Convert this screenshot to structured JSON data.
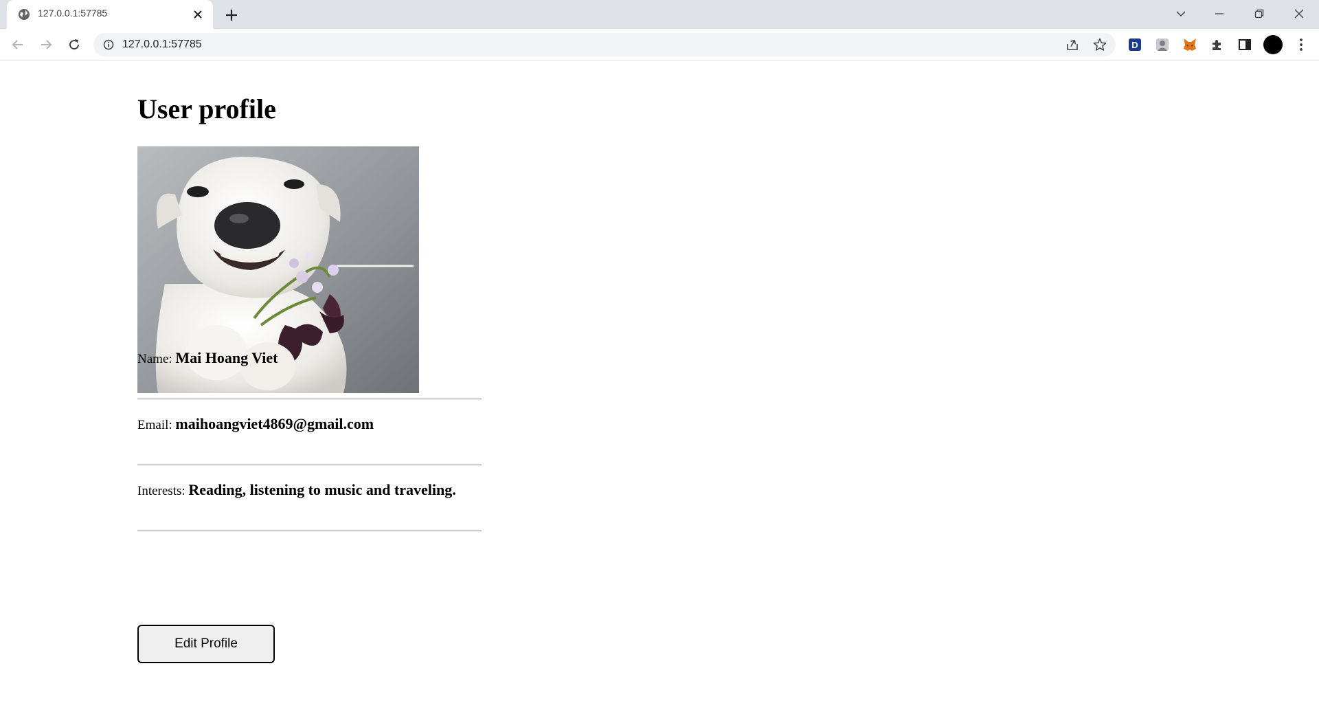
{
  "browser": {
    "tab_title": "127.0.0.1:57785",
    "url": "127.0.0.1:57785"
  },
  "page": {
    "title": "User profile",
    "fields": [
      {
        "label": "Name:",
        "value": "Mai Hoang Viet"
      },
      {
        "label": "Email:",
        "value": "maihoangviet4869@gmail.com"
      },
      {
        "label": "Interests:",
        "value": "Reading, listening to music and traveling."
      }
    ],
    "edit_button": "Edit Profile"
  },
  "icons": {
    "tab_favicon": "globe-icon",
    "tab_close": "close-icon",
    "new_tab": "plus-icon",
    "back": "back-arrow-icon",
    "forward": "forward-arrow-icon",
    "reload": "reload-icon",
    "site_info": "info-icon",
    "share": "share-icon",
    "bookmark": "star-icon",
    "extensions": [
      "dashlane-extension-icon",
      "profile-extension-icon",
      "metamask-fox-icon",
      "puzzle-extensions-icon",
      "side-panel-icon",
      "profile-avatar-icon",
      "kebab-menu-icon"
    ]
  },
  "colors": {
    "tabbar": "#dee1e6",
    "omnibox": "#f1f3f4",
    "button_bg": "#efefef"
  }
}
